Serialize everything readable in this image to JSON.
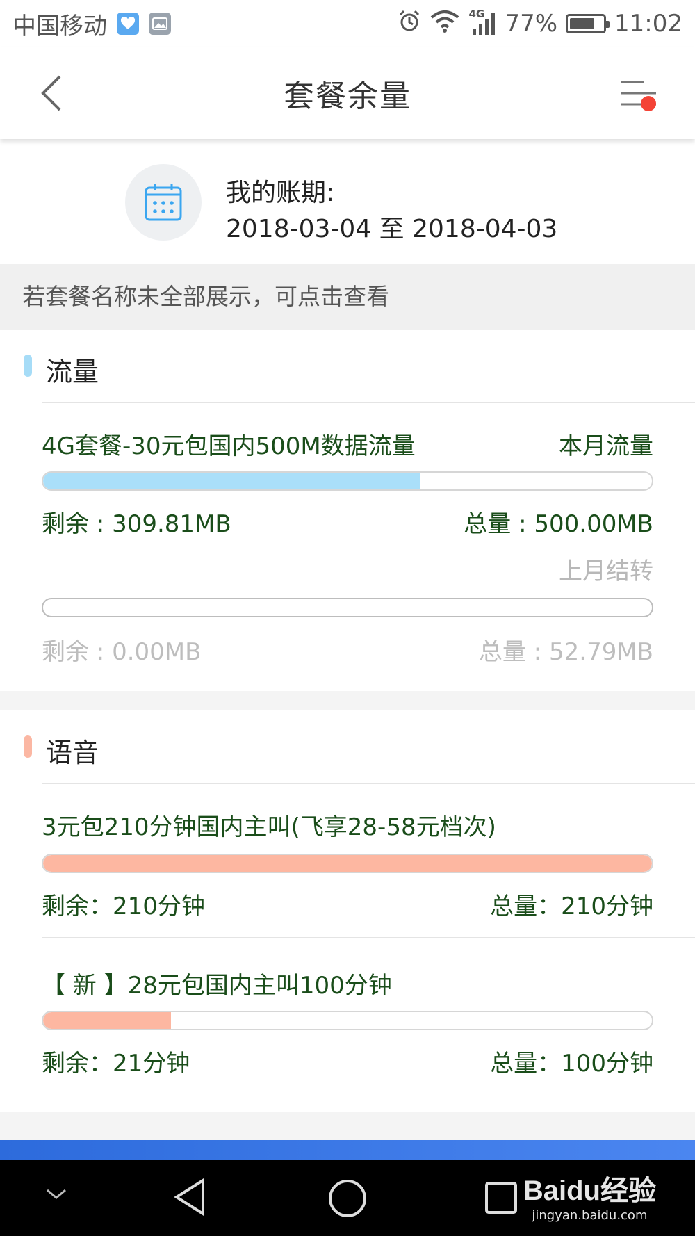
{
  "status_bar": {
    "carrier": "中国移动",
    "network": "4G",
    "battery": "77%",
    "battery_level": 0.77,
    "time": "11:02"
  },
  "nav": {
    "title": "套餐余量",
    "menu_has_notification": true
  },
  "billing": {
    "label": "我的账期:",
    "dates": "2018-03-04 至 2018-04-03"
  },
  "hint": "若套餐名称未全部展示，可点击查看",
  "data_section": {
    "title": "流量",
    "marker_color": "#a6dcf7",
    "packages": [
      {
        "name": "4G套餐-30元包国内500M数据流量",
        "tag": "本月流量",
        "remaining": "剩余 : 309.81MB",
        "total": "总量 : 500.00MB",
        "fraction_remaining": 0.62,
        "color": "#aadff9"
      },
      {
        "name": "",
        "tag": "上月结转",
        "remaining": "剩余 : 0.00MB",
        "total": "总量 : 52.79MB",
        "fraction_remaining": 0.0,
        "color": "#aadff9"
      }
    ]
  },
  "voice_section": {
    "title": "语音",
    "marker_color": "#fbb7a3",
    "packages": [
      {
        "name": "3元包210分钟国内主叫(飞享28-58元档次)",
        "remaining": "剩余：210分钟",
        "total": "总量：210分钟",
        "fraction_remaining": 1.0,
        "color": "#fdb7a1"
      },
      {
        "name": "【 新 】28元包国内主叫100分钟",
        "remaining": "剩余：21分钟",
        "total": "总量：100分钟",
        "fraction_remaining": 0.21,
        "color": "#fdb7a1"
      }
    ]
  },
  "watermark": {
    "logo": "Baidu经验",
    "url": "jingyan.baidu.com"
  }
}
